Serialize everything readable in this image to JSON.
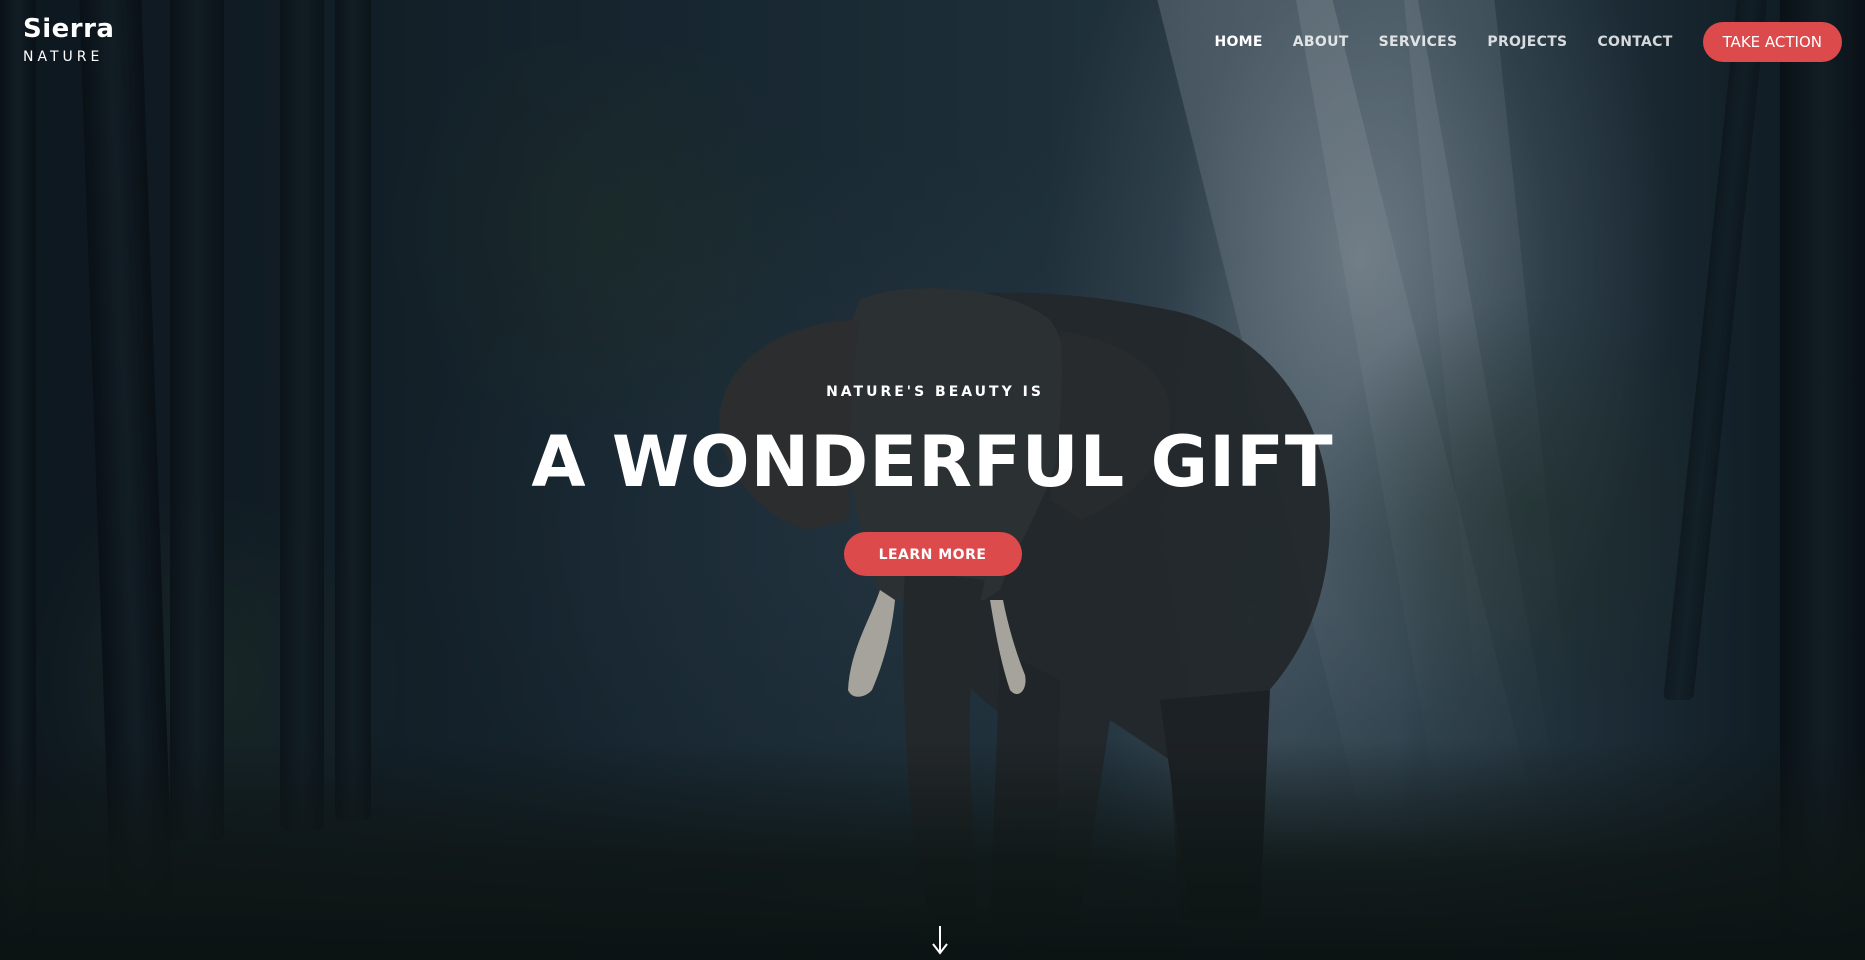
{
  "brand": {
    "name": "Sierra",
    "sub": "NATURE"
  },
  "nav": {
    "items": [
      {
        "label": "HOME",
        "active": true
      },
      {
        "label": "ABOUT",
        "active": false
      },
      {
        "label": "SERVICES",
        "active": false
      },
      {
        "label": "PROJECTS",
        "active": false
      },
      {
        "label": "CONTACT",
        "active": false
      }
    ],
    "cta_label": "TAKE ACTION"
  },
  "hero": {
    "kicker": "NATURE'S BEAUTY IS",
    "headline": "A WONDERFUL GIFT",
    "button_label": "LEARN MORE",
    "scroll_icon": "arrow-down-icon",
    "background_image": "elephant-in-misty-forest"
  },
  "colors": {
    "accent": "#dc4a4c",
    "text": "#ffffff"
  }
}
